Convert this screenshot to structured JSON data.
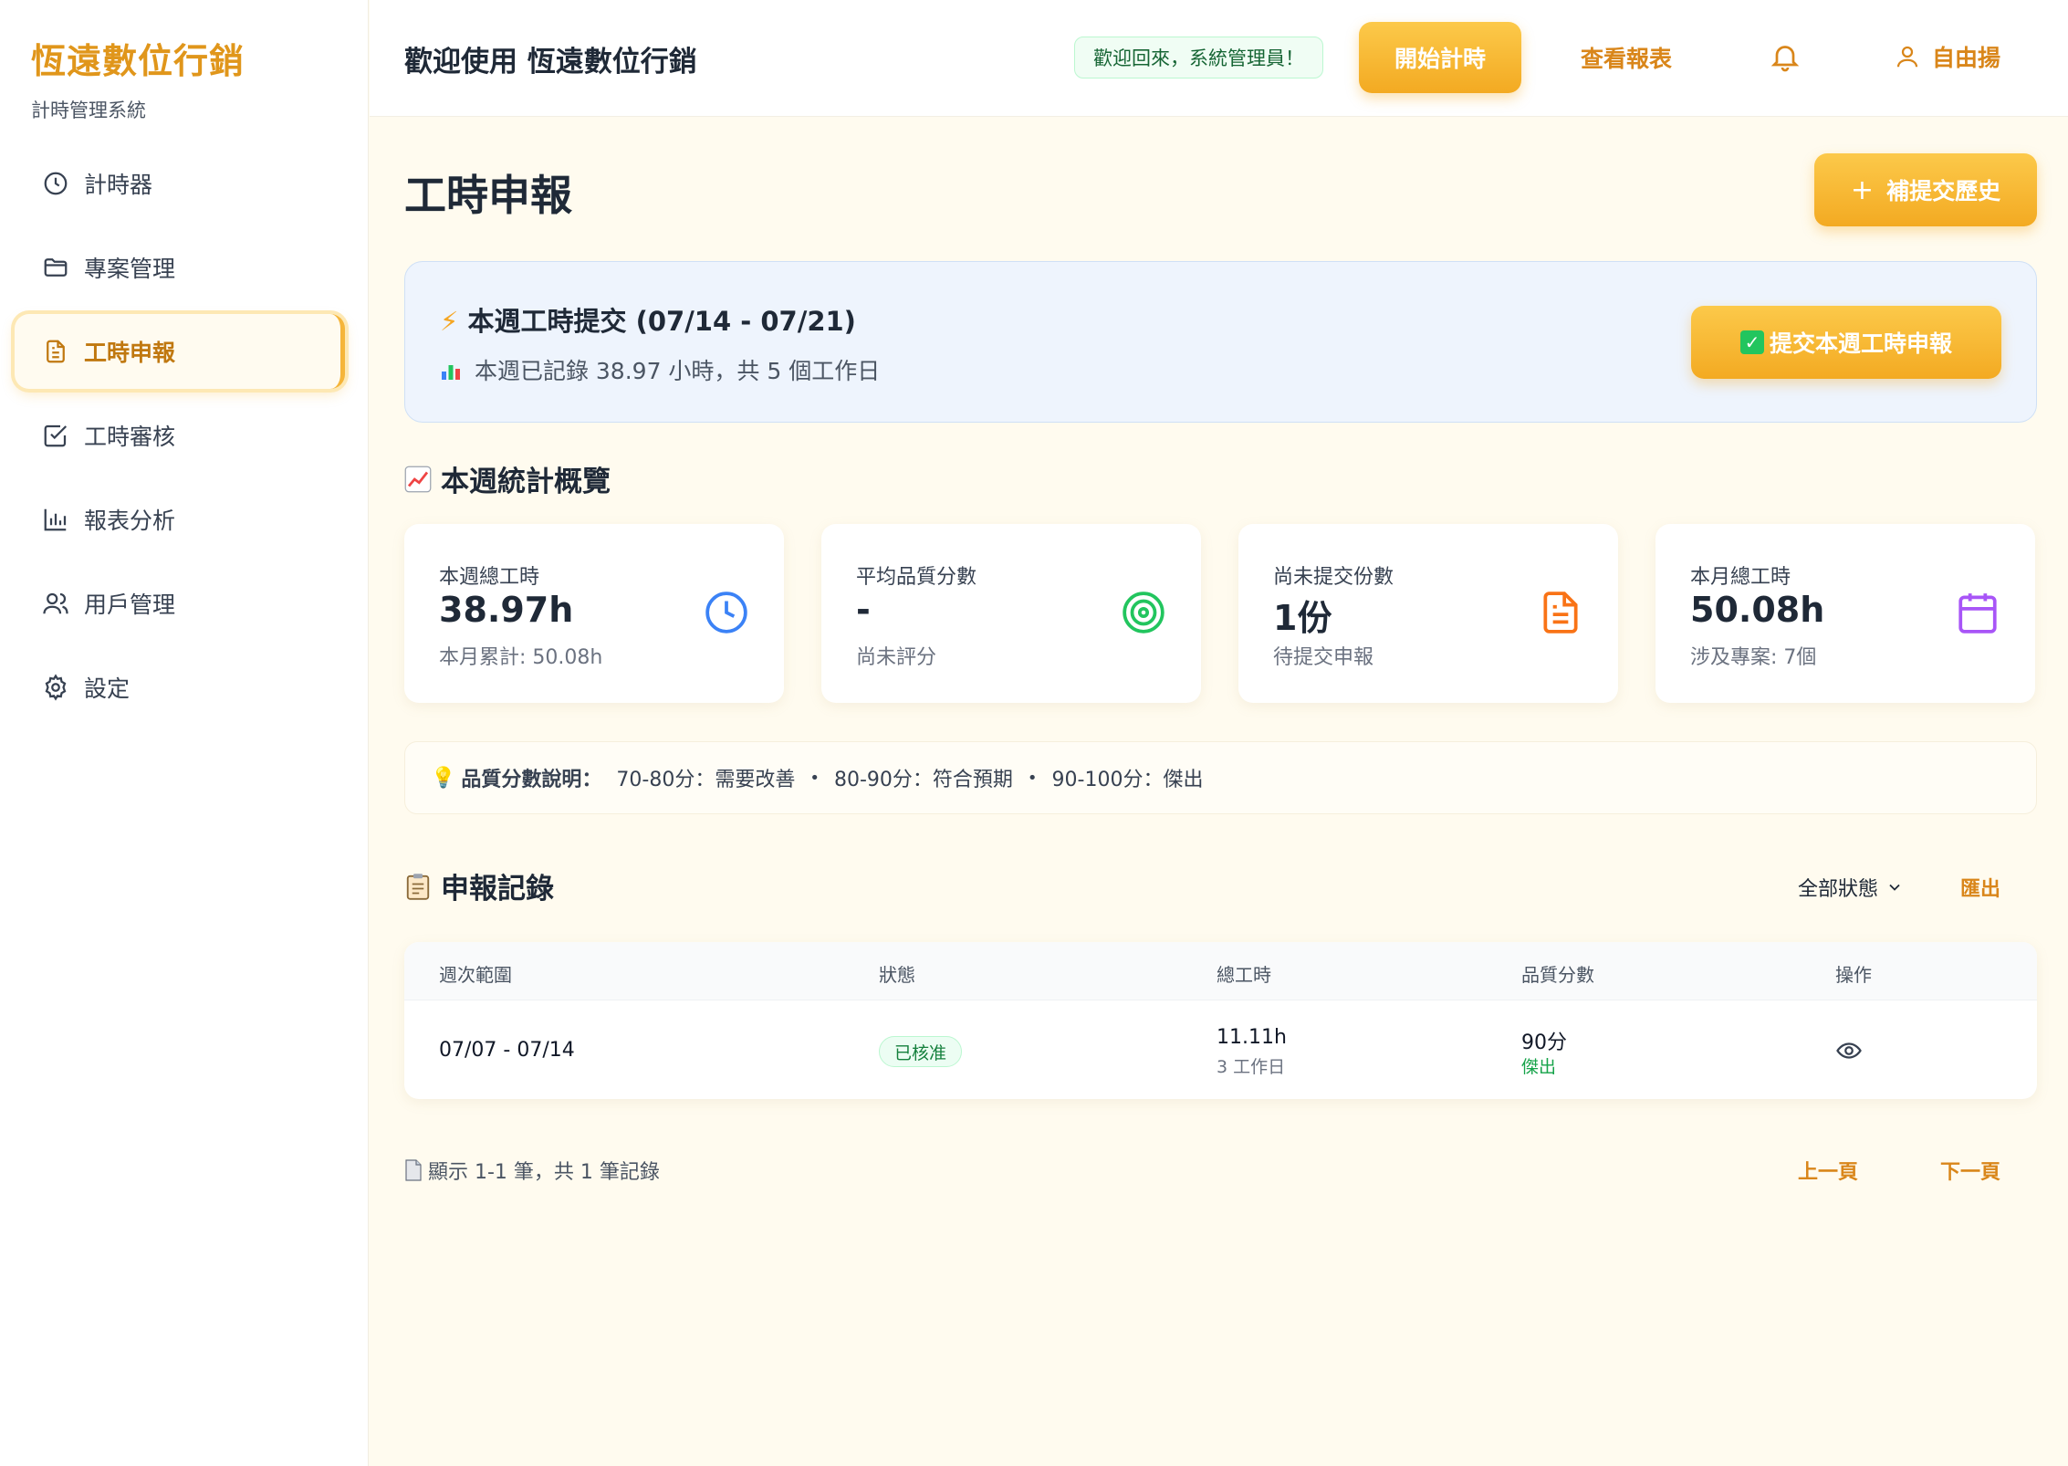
{
  "brand": {
    "name": "恆遠數位行銷",
    "subtitle": "計時管理系統"
  },
  "sidebar": {
    "items": [
      {
        "label": "計時器",
        "icon": "clock-icon",
        "active": false
      },
      {
        "label": "專案管理",
        "icon": "folder-icon",
        "active": false
      },
      {
        "label": "工時申報",
        "icon": "document-icon",
        "active": true
      },
      {
        "label": "工時審核",
        "icon": "checkbox-icon",
        "active": false
      },
      {
        "label": "報表分析",
        "icon": "bar-chart-icon",
        "active": false
      },
      {
        "label": "用戶管理",
        "icon": "users-icon",
        "active": false
      },
      {
        "label": "設定",
        "icon": "gear-icon",
        "active": false
      }
    ]
  },
  "header": {
    "title": "歡迎使用 恆遠數位行銷",
    "welcome": "歡迎回來，系統管理員！",
    "start_timer": "開始計時",
    "view_reports": "查看報表",
    "user_name": "自由揚"
  },
  "main": {
    "page_title": "工時申報",
    "backfill_button": "補提交歷史",
    "week_card": {
      "title": "本週工時提交 (07/14 - 07/21)",
      "subtitle": "本週已記錄 38.97 小時，共 5 個工作日",
      "submit_button": "提交本週工時申報"
    },
    "stats_title": "本週統計概覽",
    "stats": [
      {
        "label": "本週總工時",
        "value": "38.97h",
        "sub": "本月累計: 50.08h",
        "icon": "clock-icon",
        "color": "#3b82f6"
      },
      {
        "label": "平均品質分數",
        "value": "-",
        "sub": "尚未評分",
        "icon": "target-icon",
        "color": "#22c55e"
      },
      {
        "label": "尚未提交份數",
        "value": "1份",
        "sub": "待提交申報",
        "icon": "document-icon",
        "color": "#f97316"
      },
      {
        "label": "本月總工時",
        "value": "50.08h",
        "sub": "涉及專案: 7個",
        "icon": "calendar-icon",
        "color": "#a855f7"
      }
    ],
    "quality_legend": {
      "label": "品質分數說明：",
      "ranges": [
        "70-80分：需要改善",
        "80-90分：符合預期",
        "90-100分：傑出"
      ]
    },
    "records_title": "申報記錄",
    "filter_label": "全部狀態",
    "export_label": "匯出",
    "table": {
      "columns": [
        "週次範圍",
        "狀態",
        "總工時",
        "品質分數",
        "操作"
      ],
      "rows": [
        {
          "week": "07/07 - 07/14",
          "status": "已核准",
          "hours": "11.11h",
          "days": "3 工作日",
          "score": "90分",
          "score_label": "傑出"
        }
      ]
    },
    "pagination": {
      "info": "顯示 1-1 筆，共 1 筆記錄",
      "prev": "上一頁",
      "next": "下一頁"
    }
  },
  "colors": {
    "accent": "#f3aa22",
    "accent_text": "#d9861a",
    "success": "#15803d"
  }
}
